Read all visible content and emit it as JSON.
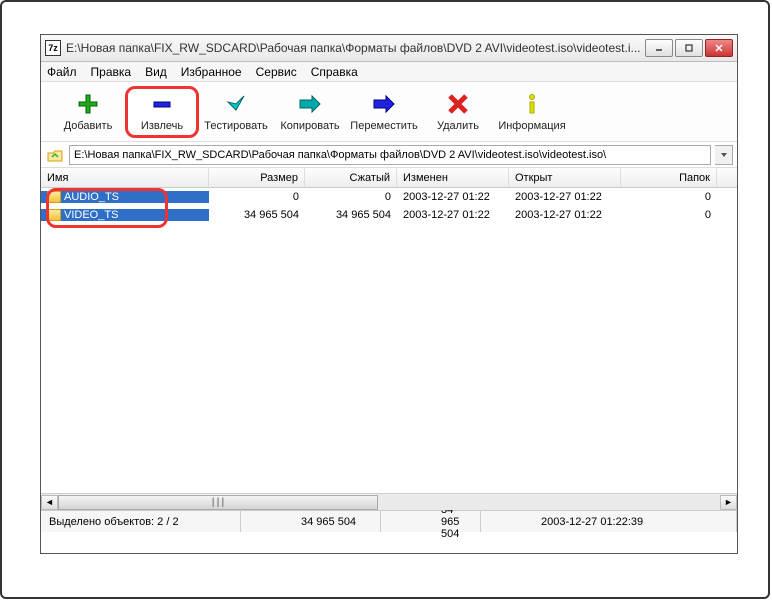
{
  "window": {
    "title": "E:\\Новая папка\\FIX_RW_SDCARD\\Рабочая папка\\Форматы файлов\\DVD 2 AVI\\videotest.iso\\videotest.i...",
    "app_icon_text": "7z"
  },
  "menu": {
    "file": "Файл",
    "edit": "Правка",
    "view": "Вид",
    "favorites": "Избранное",
    "tools": "Сервис",
    "help": "Справка"
  },
  "toolbar": {
    "add": "Добавить",
    "extract": "Извлечь",
    "test": "Тестировать",
    "copy": "Копировать",
    "move": "Переместить",
    "delete": "Удалить",
    "info": "Информация"
  },
  "address": {
    "path": "E:\\Новая папка\\FIX_RW_SDCARD\\Рабочая папка\\Форматы файлов\\DVD 2 AVI\\videotest.iso\\videotest.iso\\"
  },
  "columns": {
    "name": "Имя",
    "size": "Размер",
    "packed": "Сжатый",
    "modified": "Изменен",
    "opened": "Открыт",
    "folders": "Папок"
  },
  "rows": [
    {
      "name": "AUDIO_TS",
      "size": "0",
      "packed": "0",
      "modified": "2003-12-27 01:22",
      "opened": "2003-12-27 01:22",
      "folders": "0"
    },
    {
      "name": "VIDEO_TS",
      "size": "34 965 504",
      "packed": "34 965 504",
      "modified": "2003-12-27 01:22",
      "opened": "2003-12-27 01:22",
      "folders": "0"
    }
  ],
  "status": {
    "selected": "Выделено объектов: 2 / 2",
    "size": "34 965 504",
    "packed": "34 965 504",
    "date": "2003-12-27 01:22:39"
  }
}
